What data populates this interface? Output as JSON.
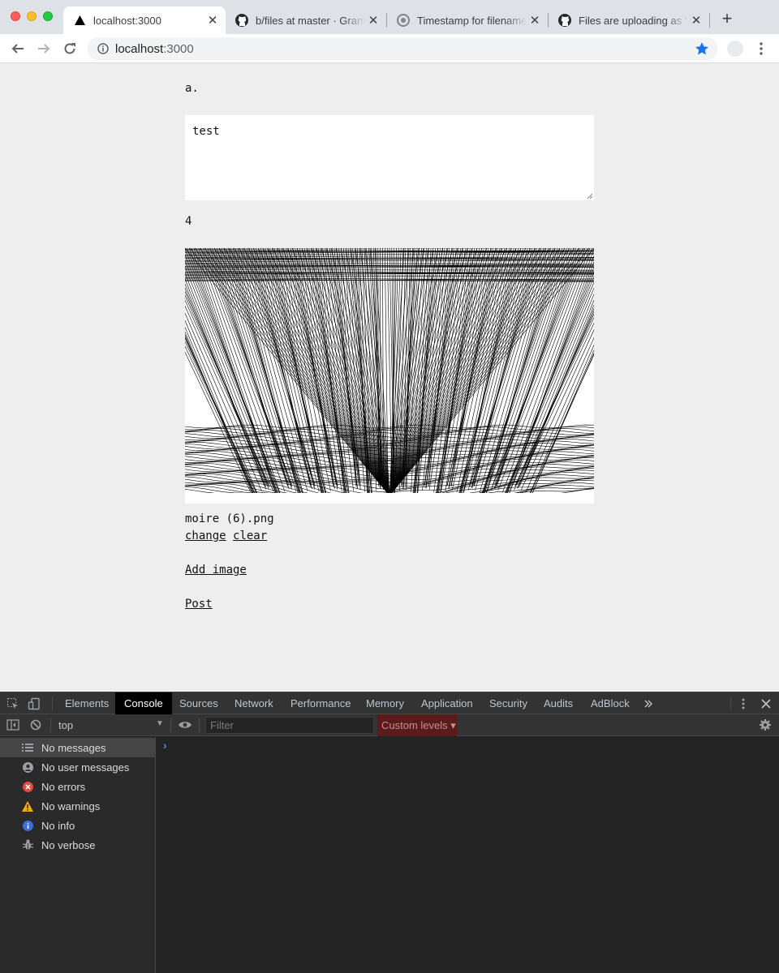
{
  "browser": {
    "tabs": [
      {
        "title": "localhost:3000",
        "favicon": "triangle-icon"
      },
      {
        "title": "b/files at master · GrantCuster",
        "favicon": "github-icon"
      },
      {
        "title": "Timestamp for filename",
        "favicon": "chrome-icon"
      },
      {
        "title": "Files are uploading as 'file'",
        "favicon": "github-icon"
      }
    ],
    "address": {
      "host": "localhost",
      "port": ":3000"
    }
  },
  "page": {
    "author": "a.",
    "textarea_value": "test",
    "count": "4",
    "image_alt": "moire pattern image",
    "filename": "moire (6).png",
    "change_label": "change",
    "clear_label": "clear",
    "add_image_label": "Add image",
    "post_label": "Post"
  },
  "devtools": {
    "tabs": [
      "Elements",
      "Console",
      "Sources",
      "Network",
      "Performance",
      "Memory",
      "Application",
      "Security",
      "Audits",
      "AdBlock"
    ],
    "active_tab": "Console",
    "context": "top",
    "filter_placeholder": "Filter",
    "levels_label": "Custom levels ▾",
    "sidebar": [
      {
        "label": "No messages",
        "icon": "list-icon"
      },
      {
        "label": "No user messages",
        "icon": "user-icon"
      },
      {
        "label": "No errors",
        "icon": "error-icon"
      },
      {
        "label": "No warnings",
        "icon": "warning-icon"
      },
      {
        "label": "No info",
        "icon": "info-icon"
      },
      {
        "label": "No verbose",
        "icon": "bug-icon"
      }
    ],
    "prompt": "›"
  },
  "colors": {
    "page_bg": "#eeeeee",
    "devtools_bg": "#242424",
    "accent": "#1a73e8",
    "error": "#e8453c",
    "warning": "#f9ab00",
    "info": "#3b6fd9"
  }
}
